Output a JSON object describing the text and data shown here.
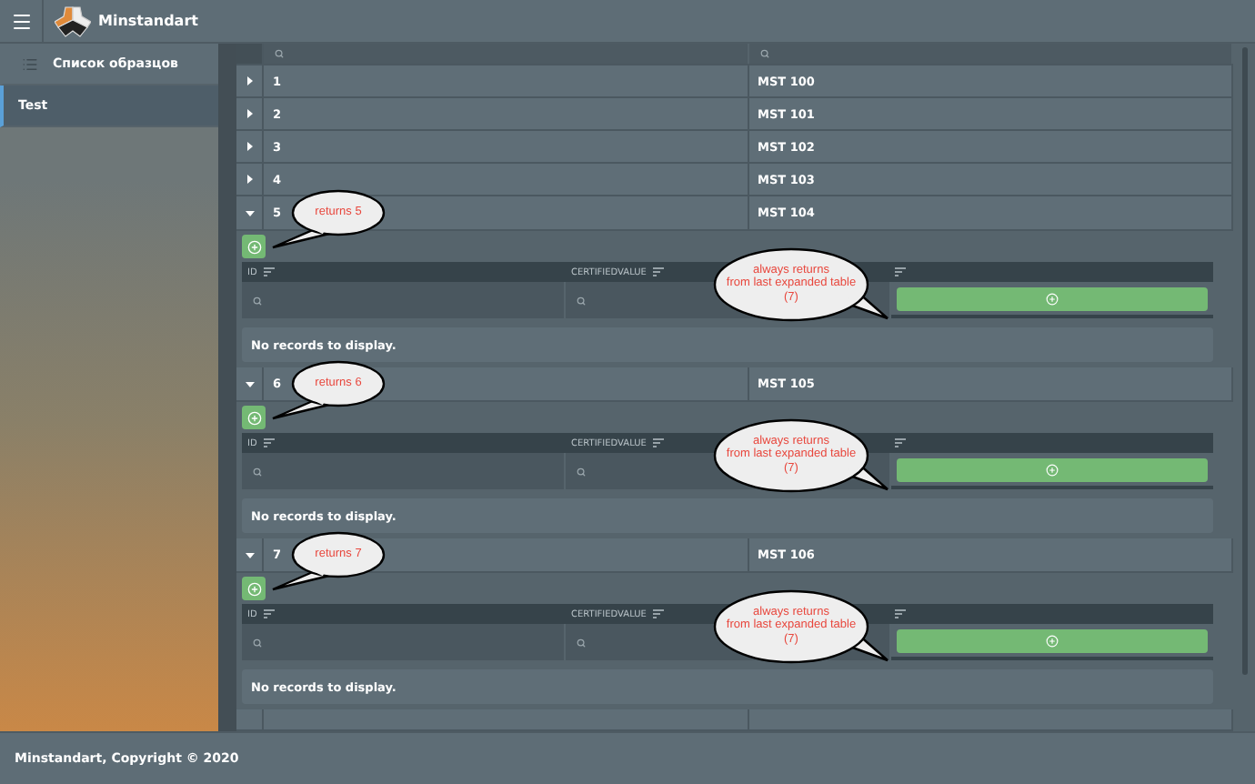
{
  "app": {
    "title": "Minstandart"
  },
  "sidebar": {
    "items": [
      {
        "label": "Список образцов",
        "selected": false
      },
      {
        "label": "Test",
        "selected": true
      }
    ]
  },
  "grid": {
    "rows": [
      {
        "id": "1",
        "code": "MST 100",
        "expanded": false
      },
      {
        "id": "2",
        "code": "MST 101",
        "expanded": false
      },
      {
        "id": "3",
        "code": "MST 102",
        "expanded": false
      },
      {
        "id": "4",
        "code": "MST 103",
        "expanded": false
      },
      {
        "id": "5",
        "code": "MST 104",
        "expanded": true,
        "detail": {
          "columns": [
            "ID",
            "CERTIFIEDVALUE"
          ],
          "empty_text": "No records to display.",
          "callouts": [
            {
              "kind": "small",
              "text": "returns 5"
            },
            {
              "kind": "large",
              "text": "always returns\nfrom last expanded table\n(7)"
            }
          ]
        }
      },
      {
        "id": "6",
        "code": "MST 105",
        "expanded": true,
        "detail": {
          "columns": [
            "ID",
            "CERTIFIEDVALUE"
          ],
          "empty_text": "No records to display.",
          "callouts": [
            {
              "kind": "small",
              "text": "returns 6"
            },
            {
              "kind": "large",
              "text": "always returns\nfrom last expanded table\n(7)"
            }
          ]
        }
      },
      {
        "id": "7",
        "code": "MST 106",
        "expanded": true,
        "detail": {
          "columns": [
            "ID",
            "CERTIFIEDVALUE"
          ],
          "empty_text": "No records to display.",
          "callouts": [
            {
              "kind": "small",
              "text": "returns 7"
            },
            {
              "kind": "large",
              "text": "always returns\nfrom last expanded table\n(7)"
            }
          ]
        }
      }
    ]
  },
  "footer": {
    "text": "Minstandart, Copyright © 2020"
  }
}
